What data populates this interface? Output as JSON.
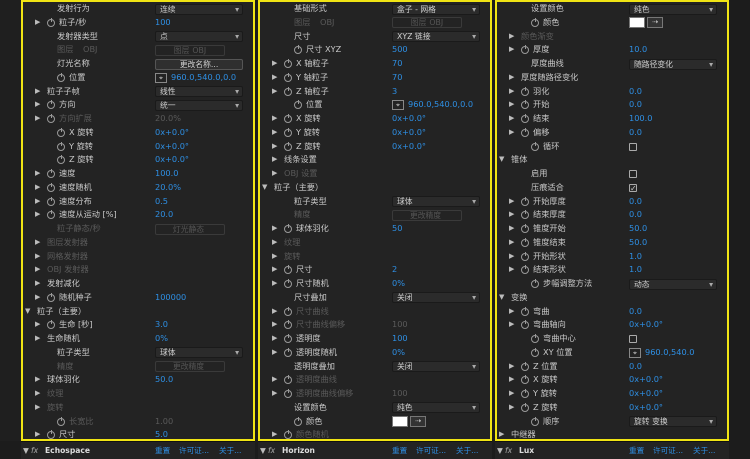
{
  "panel1": {
    "rows": [
      {
        "type": "select",
        "label": "发射行为",
        "value": "连续",
        "indent": 3
      },
      {
        "type": "value",
        "label": "粒子/秒",
        "value": "100",
        "indent": 2,
        "tw": true,
        "sw": true
      },
      {
        "type": "select",
        "label": "发射器类型",
        "value": "点",
        "indent": 3
      },
      {
        "type": "dis2",
        "label": "图层",
        "value": "OBJ",
        "label2": "图层",
        "value2": "OBJ",
        "indent": 3
      },
      {
        "type": "button",
        "label": "灯光名称",
        "value": "更改名称...",
        "indent": 3
      },
      {
        "type": "point",
        "label": "位置",
        "value": "960.0,540.0,0.0",
        "indent": 3,
        "sw": true
      },
      {
        "type": "select",
        "label": "粒子子帧",
        "value": "线性",
        "indent": 2,
        "tw": true
      },
      {
        "type": "select",
        "label": "方向",
        "value": "统一",
        "indent": 2,
        "tw": true,
        "sw": true
      },
      {
        "type": "disval",
        "label": "方向扩展",
        "value": "20.0%",
        "indent": 2,
        "tw": true,
        "sw": true
      },
      {
        "type": "value",
        "label": "X 旋转",
        "value": "0x+0.0°",
        "indent": 3,
        "sw": true
      },
      {
        "type": "value",
        "label": "Y 旋转",
        "value": "0x+0.0°",
        "indent": 3,
        "sw": true
      },
      {
        "type": "value",
        "label": "Z 旋转",
        "value": "0x+0.0°",
        "indent": 3,
        "sw": true
      },
      {
        "type": "value",
        "label": "速度",
        "value": "100.0",
        "indent": 2,
        "tw": true,
        "sw": true
      },
      {
        "type": "value",
        "label": "速度随机",
        "value": "20.0%",
        "indent": 2,
        "tw": true,
        "sw": true
      },
      {
        "type": "value",
        "label": "速度分布",
        "value": "0.5",
        "indent": 2,
        "tw": true,
        "sw": true
      },
      {
        "type": "value",
        "label": "速度从运动 [%]",
        "value": "20.0",
        "indent": 2,
        "tw": true,
        "sw": true
      },
      {
        "type": "dis2",
        "label": "粒子静态/秒",
        "value": "",
        "label2": "灯光静态",
        "value2": "",
        "indent": 3
      },
      {
        "type": "dis",
        "label": "图层发射器",
        "indent": 2,
        "tw": true
      },
      {
        "type": "dis",
        "label": "网格发射器",
        "indent": 2,
        "tw": true
      },
      {
        "type": "dis",
        "label": "OBJ 发射器",
        "indent": 2,
        "tw": true
      },
      {
        "type": "plain",
        "label": "发射减化",
        "indent": 2,
        "tw": true
      },
      {
        "type": "value",
        "label": "随机种子",
        "value": "100000",
        "indent": 2,
        "tw": true,
        "sw": true
      },
      {
        "type": "section",
        "label": "粒子（主要）",
        "indent": 1
      },
      {
        "type": "value",
        "label": "生命 [秒]",
        "value": "3.0",
        "indent": 2,
        "tw": true,
        "sw": true
      },
      {
        "type": "value",
        "label": "生命随机",
        "value": "0%",
        "indent": 2,
        "tw": true
      },
      {
        "type": "select",
        "label": "粒子类型",
        "value": "球体",
        "indent": 3
      },
      {
        "type": "dis2",
        "label": "精度",
        "value": "",
        "label2": "更改精度",
        "value2": "",
        "indent": 3
      },
      {
        "type": "value",
        "label": "球体羽化",
        "value": "50.0",
        "indent": 2,
        "tw": true
      },
      {
        "type": "dis",
        "label": "纹理",
        "indent": 2,
        "tw": true
      },
      {
        "type": "dis",
        "label": "旋转",
        "indent": 2,
        "tw": true
      },
      {
        "type": "disval",
        "label": "长宽比",
        "value": "1.00",
        "indent": 3,
        "sw": true
      },
      {
        "type": "value",
        "label": "尺寸",
        "value": "5.0",
        "indent": 2,
        "tw": true,
        "sw": true
      }
    ]
  },
  "panel2": {
    "rows": [
      {
        "type": "select",
        "label": "基础形式",
        "value": "盒子 - 网格",
        "indent": 3
      },
      {
        "type": "dis2",
        "label": "图层",
        "value": "OBJ",
        "label2": "图层",
        "value2": "OBJ",
        "indent": 3
      },
      {
        "type": "select",
        "label": "尺寸",
        "value": "XYZ 链接",
        "indent": 3
      },
      {
        "type": "value",
        "label": "尺寸 XYZ",
        "value": "500",
        "indent": 3,
        "sw": true
      },
      {
        "type": "value",
        "label": "X 轴粒子",
        "value": "70",
        "indent": 2,
        "tw": true,
        "sw": true
      },
      {
        "type": "value",
        "label": "Y 轴粒子",
        "value": "70",
        "indent": 2,
        "tw": true,
        "sw": true
      },
      {
        "type": "value",
        "label": "Z 轴粒子",
        "value": "3",
        "indent": 2,
        "tw": true,
        "sw": true
      },
      {
        "type": "point",
        "label": "位置",
        "value": "960.0,540.0,0.0",
        "indent": 3,
        "sw": true
      },
      {
        "type": "value",
        "label": "X 旋转",
        "value": "0x+0.0°",
        "indent": 2,
        "tw": true,
        "sw": true
      },
      {
        "type": "value",
        "label": "Y 旋转",
        "value": "0x+0.0°",
        "indent": 2,
        "tw": true,
        "sw": true
      },
      {
        "type": "value",
        "label": "Z 旋转",
        "value": "0x+0.0°",
        "indent": 2,
        "tw": true,
        "sw": true
      },
      {
        "type": "plain",
        "label": "线条设置",
        "indent": 2,
        "tw": true
      },
      {
        "type": "dis",
        "label": "OBJ 设置",
        "indent": 2,
        "tw": true
      },
      {
        "type": "section",
        "label": "粒子（主要）",
        "indent": 1
      },
      {
        "type": "select",
        "label": "粒子类型",
        "value": "球体",
        "indent": 3
      },
      {
        "type": "dis2",
        "label": "精度",
        "value": "",
        "label2": "更改精度",
        "value2": "",
        "indent": 3
      },
      {
        "type": "value",
        "label": "球体羽化",
        "value": "50",
        "indent": 2,
        "tw": true,
        "sw": true
      },
      {
        "type": "dis",
        "label": "纹理",
        "indent": 2,
        "tw": true
      },
      {
        "type": "dis",
        "label": "旋转",
        "indent": 2,
        "tw": true
      },
      {
        "type": "value",
        "label": "尺寸",
        "value": "2",
        "indent": 2,
        "tw": true,
        "sw": true
      },
      {
        "type": "value",
        "label": "尺寸随机",
        "value": "0%",
        "indent": 2,
        "tw": true,
        "sw": true
      },
      {
        "type": "select",
        "label": "尺寸叠加",
        "value": "关闭",
        "indent": 3
      },
      {
        "type": "dis",
        "label": "尺寸曲线",
        "indent": 2,
        "tw": true,
        "sw": true
      },
      {
        "type": "disval",
        "label": "尺寸曲线偏移",
        "value": "100",
        "indent": 2,
        "tw": true,
        "sw": true
      },
      {
        "type": "value",
        "label": "透明度",
        "value": "100",
        "indent": 2,
        "tw": true,
        "sw": true
      },
      {
        "type": "value",
        "label": "透明度随机",
        "value": "0%",
        "indent": 2,
        "tw": true,
        "sw": true
      },
      {
        "type": "select",
        "label": "透明度叠加",
        "value": "关闭",
        "indent": 3
      },
      {
        "type": "dis",
        "label": "透明度曲线",
        "indent": 2,
        "tw": true,
        "sw": true
      },
      {
        "type": "disval",
        "label": "透明度曲线偏移",
        "value": "100",
        "indent": 2,
        "tw": true,
        "sw": true
      },
      {
        "type": "select",
        "label": "设置颜色",
        "value": "纯色",
        "indent": 3
      },
      {
        "type": "color",
        "label": "颜色",
        "indent": 3,
        "sw": true
      },
      {
        "type": "dis",
        "label": "颜色随机",
        "indent": 2,
        "tw": true,
        "sw": true
      }
    ]
  },
  "panel3": {
    "rows": [
      {
        "type": "select",
        "label": "设置颜色",
        "value": "纯色",
        "indent": 3
      },
      {
        "type": "color",
        "label": "颜色",
        "indent": 3,
        "sw": true
      },
      {
        "type": "dis",
        "label": "颜色渐变",
        "indent": 2,
        "tw": true
      },
      {
        "type": "value",
        "label": "厚度",
        "value": "10.0",
        "indent": 2,
        "tw": true,
        "sw": true
      },
      {
        "type": "select",
        "label": "厚度曲线",
        "value": "随路径变化",
        "indent": 3
      },
      {
        "type": "plain",
        "label": "厚度随路径变化",
        "indent": 2,
        "tw": true
      },
      {
        "type": "value",
        "label": "羽化",
        "value": "0.0",
        "indent": 2,
        "tw": true,
        "sw": true
      },
      {
        "type": "value",
        "label": "开始",
        "value": "0.0",
        "indent": 2,
        "tw": true,
        "sw": true
      },
      {
        "type": "value",
        "label": "结束",
        "value": "100.0",
        "indent": 2,
        "tw": true,
        "sw": true
      },
      {
        "type": "value",
        "label": "偏移",
        "value": "0.0",
        "indent": 2,
        "tw": true,
        "sw": true
      },
      {
        "type": "check",
        "label": "循环",
        "on": false,
        "indent": 3,
        "sw": true
      },
      {
        "type": "section",
        "label": "锥体",
        "indent": 1
      },
      {
        "type": "check",
        "label": "启用",
        "on": false,
        "indent": 3
      },
      {
        "type": "check",
        "label": "压痕适合",
        "on": true,
        "indent": 3
      },
      {
        "type": "value",
        "label": "开始厚度",
        "value": "0.0",
        "indent": 2,
        "tw": true,
        "sw": true
      },
      {
        "type": "value",
        "label": "结束厚度",
        "value": "0.0",
        "indent": 2,
        "tw": true,
        "sw": true
      },
      {
        "type": "value",
        "label": "锥度开始",
        "value": "50.0",
        "indent": 2,
        "tw": true,
        "sw": true
      },
      {
        "type": "value",
        "label": "锥度结束",
        "value": "50.0",
        "indent": 2,
        "tw": true,
        "sw": true
      },
      {
        "type": "value",
        "label": "开始形状",
        "value": "1.0",
        "indent": 2,
        "tw": true,
        "sw": true
      },
      {
        "type": "value",
        "label": "结束形状",
        "value": "1.0",
        "indent": 2,
        "tw": true,
        "sw": true
      },
      {
        "type": "select",
        "label": "步幅调整方法",
        "value": "动态",
        "indent": 3,
        "sw": true
      },
      {
        "type": "section",
        "label": "变换",
        "indent": 1
      },
      {
        "type": "value",
        "label": "弯曲",
        "value": "0.0",
        "indent": 2,
        "tw": true,
        "sw": true
      },
      {
        "type": "value",
        "label": "弯曲轴向",
        "value": "0x+0.0°",
        "indent": 2,
        "tw": true,
        "sw": true
      },
      {
        "type": "check",
        "label": "弯曲中心",
        "on": false,
        "indent": 3,
        "sw": true
      },
      {
        "type": "point",
        "label": "XY 位置",
        "value": "960.0,540.0",
        "indent": 3,
        "sw": true
      },
      {
        "type": "value",
        "label": "Z 位置",
        "value": "0.0",
        "indent": 2,
        "tw": true,
        "sw": true
      },
      {
        "type": "value",
        "label": "X 旋转",
        "value": "0x+0.0°",
        "indent": 2,
        "tw": true,
        "sw": true
      },
      {
        "type": "value",
        "label": "Y 旋转",
        "value": "0x+0.0°",
        "indent": 2,
        "tw": true,
        "sw": true
      },
      {
        "type": "value",
        "label": "Z 旋转",
        "value": "0x+0.0°",
        "indent": 2,
        "tw": true,
        "sw": true
      },
      {
        "type": "select",
        "label": "顺序",
        "value": "旋转 变换",
        "indent": 3,
        "sw": true
      },
      {
        "type": "plain",
        "label": "中继器",
        "indent": 1,
        "tw": true
      }
    ]
  },
  "footers": [
    {
      "fx": "fx",
      "name": "Echospace",
      "reset": "重置",
      "license": "许可证...",
      "about": "关于..."
    },
    {
      "fx": "fx",
      "name": "Horizon",
      "reset": "重置",
      "license": "许可证...",
      "about": "关于..."
    },
    {
      "fx": "fx",
      "name": "Lux",
      "reset": "重置",
      "license": "许可证...",
      "about": "关于..."
    }
  ],
  "icons": {
    "twirl": "triangle-icon",
    "stopwatch": "stopwatch-icon",
    "crosshair": "crosshair-icon",
    "eyedropper": "eyedropper-icon"
  },
  "colors": {
    "accent": "#2e8fe4",
    "highlight": "#f0e414",
    "panel": "#232323"
  }
}
